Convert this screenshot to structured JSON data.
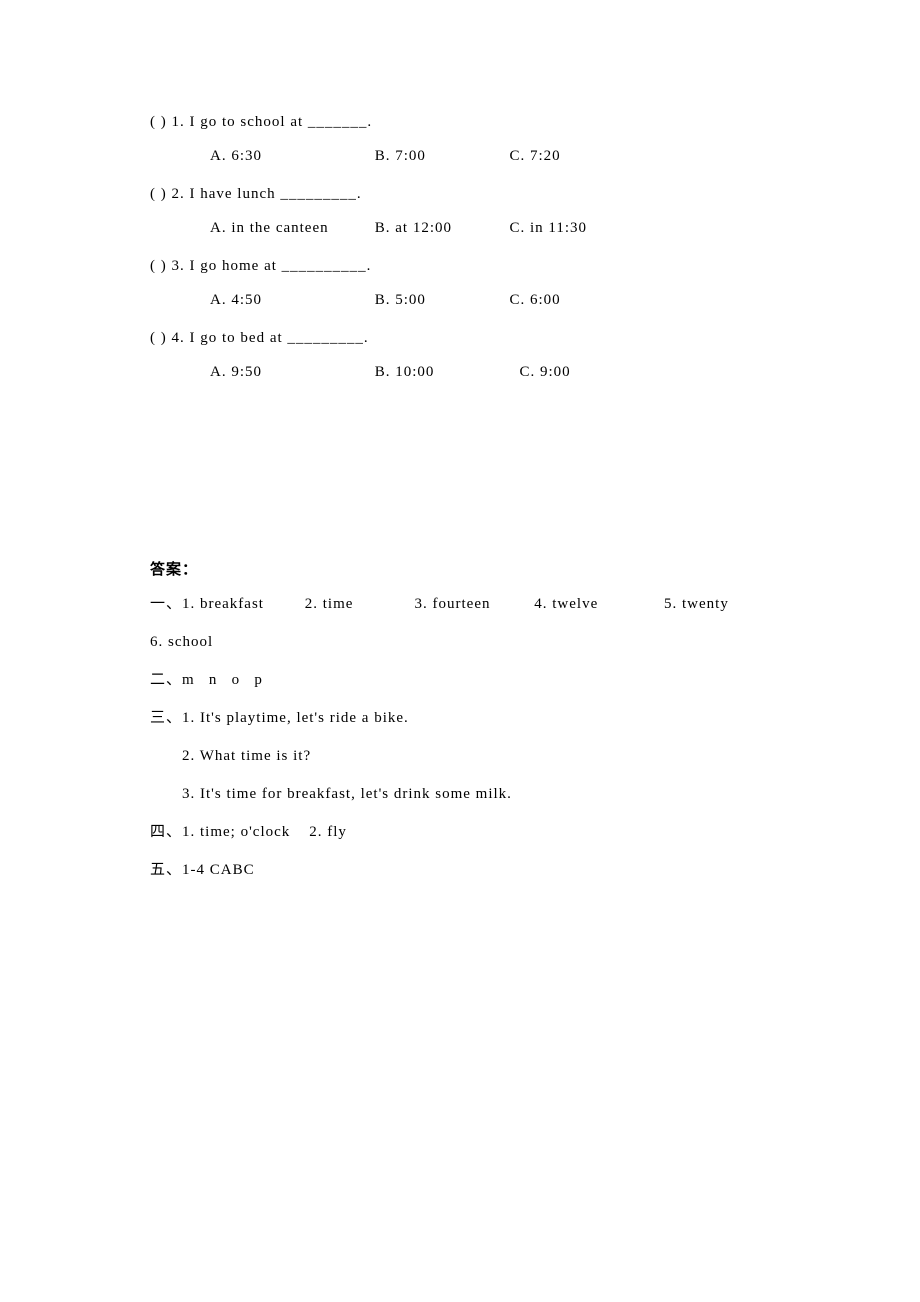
{
  "questions": [
    {
      "prefix": "(   ) 1. ",
      "text": "I go to school at _______.",
      "options": {
        "a": "A. 6:30",
        "b": "B. 7:00",
        "c": "C. 7:20"
      },
      "widths": {
        "a": "160px",
        "b": "130px",
        "c": "auto"
      }
    },
    {
      "prefix": "(   ) 2. ",
      "text": "I have lunch _________.",
      "options": {
        "a": "A. in the canteen",
        "b": "B. at 12:00",
        "c": "C. in 11:30"
      },
      "widths": {
        "a": "160px",
        "b": "130px",
        "c": "auto"
      }
    },
    {
      "prefix": "(   ) 3. ",
      "text": "I go home at __________.",
      "options": {
        "a": "A. 4:50",
        "b": "B. 5:00",
        "c": "C. 6:00"
      },
      "widths": {
        "a": "160px",
        "b": "130px",
        "c": "auto"
      }
    },
    {
      "prefix": "(   ) 4. ",
      "text": "I go to bed at _________.",
      "options": {
        "a": "A. 9:50",
        "b": "B. 10:00",
        "c": "C. 9:00"
      },
      "widths": {
        "a": "160px",
        "b": "140px",
        "c": "auto"
      }
    }
  ],
  "answers": {
    "heading": "答案：",
    "line1_parts": {
      "p1": "一、1. breakfast",
      "p2": "2. time",
      "p3": "3. fourteen",
      "p4": "4. twelve",
      "p5": "5. twenty"
    },
    "line1b": "6. school",
    "line2": "二、m   n   o   p",
    "line3": "三、1. It's playtime, let's ride a bike.",
    "line3b": "2. What time is it?",
    "line3c": "3. It's time for breakfast, let's drink some milk.",
    "line4": "四、1. time; o'clock    2. fly",
    "line5": "五、1-4 CABC"
  }
}
